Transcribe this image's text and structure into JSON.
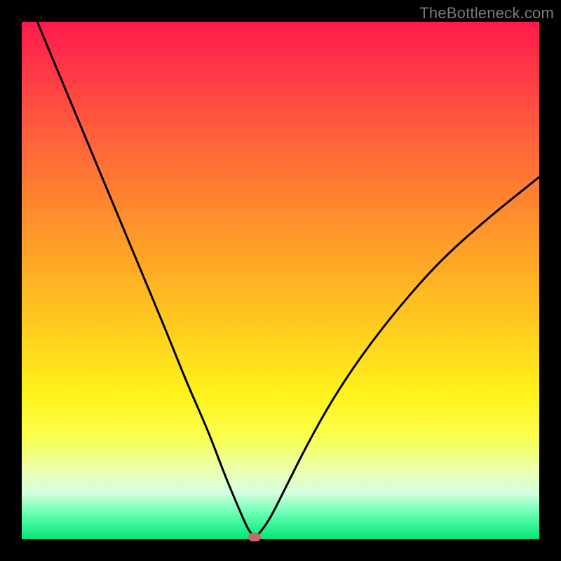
{
  "watermark": "TheBottleneck.com",
  "chart_data": {
    "type": "line",
    "title": "",
    "xlabel": "",
    "ylabel": "",
    "xlim": [
      0,
      100
    ],
    "ylim": [
      0,
      100
    ],
    "grid": false,
    "series": [
      {
        "name": "bottleneck-curve",
        "x": [
          3,
          8,
          13,
          18,
          23,
          28,
          32,
          36,
          39,
          41.5,
          43,
          44,
          45,
          46,
          48,
          51,
          55,
          60,
          66,
          73,
          81,
          90,
          100
        ],
        "y": [
          100,
          88,
          76,
          64,
          52,
          40,
          30,
          21,
          13,
          7,
          3.5,
          1.5,
          0.4,
          1.2,
          4,
          10,
          18,
          27,
          36,
          45,
          54,
          62,
          70
        ]
      }
    ],
    "marker": {
      "x": 45,
      "y": 0.4
    },
    "colors": {
      "curve": "#000000",
      "marker": "#c96a6a",
      "gradient_top": "#ff1a4d",
      "gradient_bottom": "#00e676"
    }
  }
}
